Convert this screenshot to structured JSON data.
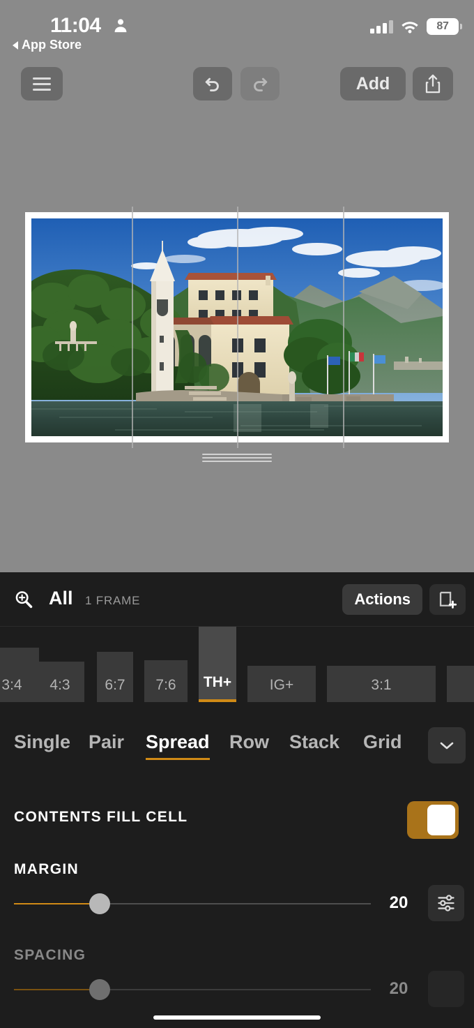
{
  "status_bar": {
    "time": "11:04",
    "person_icon": "person-icon",
    "back_link": "App Store",
    "cellular_icon": "cellular-bars-icon",
    "wifi_icon": "wifi-icon",
    "battery_level": "87"
  },
  "toolbar": {
    "menu_icon": "hamburger-menu-icon",
    "undo_icon": "undo-arrow-icon",
    "redo_icon": "redo-arrow-icon",
    "add_label": "Add",
    "share_icon": "share-upload-icon"
  },
  "canvas": {
    "grip_icon": "resize-grip-handle",
    "guide_count": 3,
    "photo_alt": "Villa on a lakeside promontory with bell tower, lake and mountains"
  },
  "panel": {
    "zoom_icon": "zoom-in-magnifier-icon",
    "scope_label": "All",
    "frame_count_label": "1 FRAME",
    "actions_label": "Actions",
    "new_frame_icon": "add-frame-icon"
  },
  "ratios": {
    "items": [
      {
        "label": "3:4",
        "selected": false
      },
      {
        "label": "4:3",
        "selected": false
      },
      {
        "label": "6:7",
        "selected": false
      },
      {
        "label": "7:6",
        "selected": false
      },
      {
        "label": "TH+",
        "selected": true
      },
      {
        "label": "IG+",
        "selected": false
      },
      {
        "label": "3:1",
        "selected": false
      }
    ]
  },
  "layouts": {
    "items": [
      {
        "label": "Single",
        "selected": false
      },
      {
        "label": "Pair",
        "selected": false
      },
      {
        "label": "Spread",
        "selected": true
      },
      {
        "label": "Row",
        "selected": false
      },
      {
        "label": "Stack",
        "selected": false
      },
      {
        "label": "Grid",
        "selected": false
      }
    ],
    "more_icon": "chevron-down-icon"
  },
  "settings": {
    "contents_fill_cell": {
      "label": "CONTENTS FILL CELL",
      "enabled": true,
      "accent": "#a9731a"
    },
    "margin": {
      "label": "MARGIN",
      "value": "20",
      "percent": 21,
      "disabled": false,
      "detail_icon": "sliders-settings-icon"
    },
    "spacing": {
      "label": "SPACING",
      "value": "20",
      "percent": 21,
      "disabled": true,
      "detail_icon": "sliders-settings-icon"
    }
  },
  "colors": {
    "accent": "#d08a16",
    "toggle_on": "#a9731a",
    "panel_bg": "#1d1d1d",
    "app_bg": "#8a8a8a"
  },
  "home_indicator": "home-indicator"
}
